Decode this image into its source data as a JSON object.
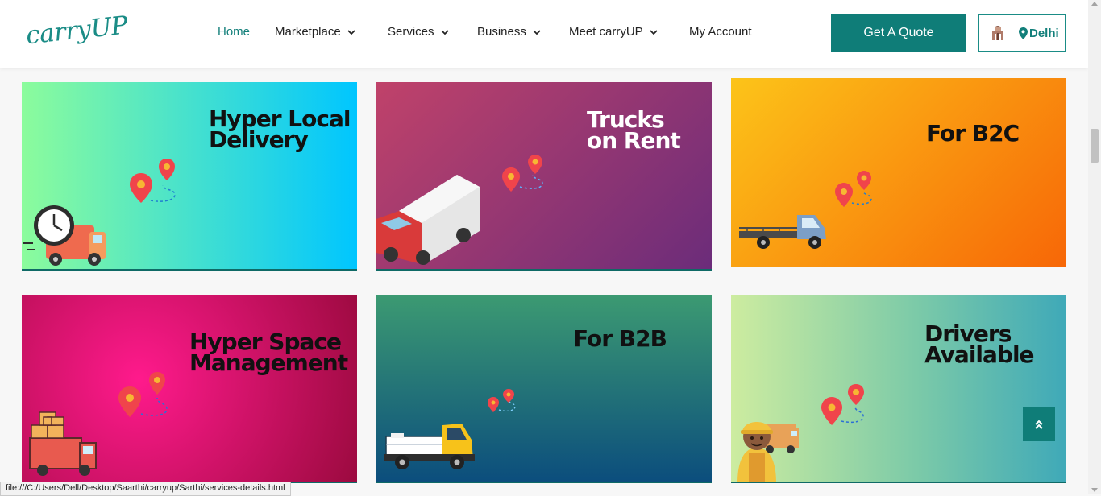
{
  "brand": {
    "logo_text": "carryUP"
  },
  "nav": {
    "items": [
      {
        "label": "Home",
        "active": true,
        "dropdown": false
      },
      {
        "label": "Marketplace",
        "active": false,
        "dropdown": true
      },
      {
        "label": "Services",
        "active": false,
        "dropdown": true
      },
      {
        "label": "Business",
        "active": false,
        "dropdown": true
      },
      {
        "label": "Meet carryUP",
        "active": false,
        "dropdown": true
      },
      {
        "label": "My Account",
        "active": false,
        "dropdown": false
      }
    ]
  },
  "header": {
    "quote_button": "Get A Quote",
    "city": "Delhi"
  },
  "cards": [
    {
      "title": "Hyper Local\nDelivery",
      "icon": "delivery-truck-clock-icon"
    },
    {
      "title": "Trucks\non Rent",
      "icon": "box-truck-icon"
    },
    {
      "title": "For B2C",
      "icon": "pickup-truck-icon"
    },
    {
      "title": "Hyper Space\nManagement",
      "icon": "boxes-truck-icon"
    },
    {
      "title": "For  B2B",
      "icon": "flatbed-truck-icon"
    },
    {
      "title": "Drivers\nAvailable",
      "icon": "driver-icon"
    }
  ],
  "colors": {
    "brand": "#0f7d78",
    "card_gradients": [
      [
        "#8cfc9c",
        "#00c6ff"
      ],
      [
        "#c0426a",
        "#6b2c7a"
      ],
      [
        "#fcc419",
        "#f76707"
      ],
      [
        "#e8117a",
        "#9b0a3f"
      ],
      [
        "#3c9a72",
        "#0b4d7d"
      ],
      [
        "#cdeca0",
        "#3fa9b8"
      ]
    ]
  },
  "status_bar": {
    "url": "file:///C:/Users/Dell/Desktop/Saarthi/carryup/Sarthi/services-details.html"
  }
}
